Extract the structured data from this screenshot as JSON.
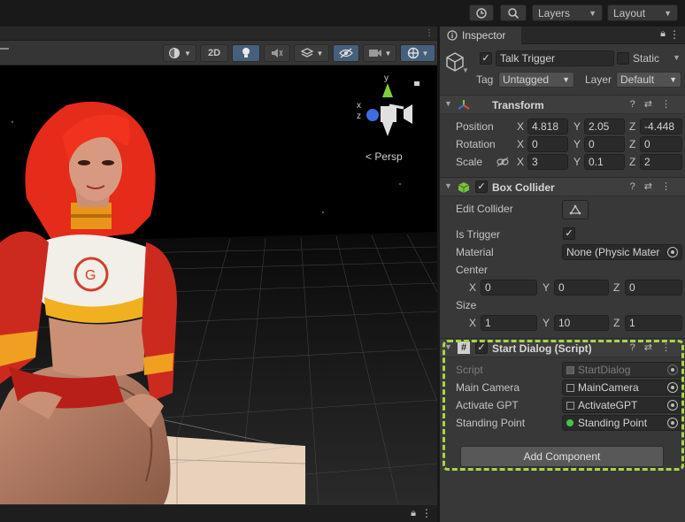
{
  "topbar": {
    "layers_label": "Layers",
    "layout_label": "Layout"
  },
  "scene": {
    "toolbar": {
      "mode_2d": "2D"
    },
    "gizmo": {
      "x": "x",
      "y": "y",
      "z": "z",
      "projection": "Persp"
    }
  },
  "inspector": {
    "tab_label": "Inspector",
    "object": {
      "name": "Talk Trigger",
      "static_label": "Static",
      "static_checked": false,
      "active_checked": true,
      "tag_label": "Tag",
      "tag_value": "Untagged",
      "layer_label": "Layer",
      "layer_value": "Default"
    },
    "transform": {
      "title": "Transform",
      "position_label": "Position",
      "rotation_label": "Rotation",
      "scale_label": "Scale",
      "axis_x": "X",
      "axis_y": "Y",
      "axis_z": "Z",
      "position": {
        "x": "4.818",
        "y": "2.05",
        "z": "-4.448"
      },
      "rotation": {
        "x": "0",
        "y": "0",
        "z": "0"
      },
      "scale": {
        "x": "3",
        "y": "0.1",
        "z": "2"
      }
    },
    "box_collider": {
      "title": "Box Collider",
      "edit_collider_label": "Edit Collider",
      "is_trigger_label": "Is Trigger",
      "is_trigger_checked": true,
      "material_label": "Material",
      "material_value": "None (Physic Mater",
      "center_label": "Center",
      "center": {
        "x": "0",
        "y": "0",
        "z": "0"
      },
      "size_label": "Size",
      "size": {
        "x": "1",
        "y": "10",
        "z": "1"
      }
    },
    "start_dialog": {
      "title": "Start Dialog (Script)",
      "script_label": "Script",
      "script_value": "StartDialog",
      "main_camera_label": "Main Camera",
      "main_camera_value": "MainCamera",
      "activate_gpt_label": "Activate GPT",
      "activate_gpt_value": "ActivateGPT",
      "standing_point_label": "Standing Point",
      "standing_point_value": "Standing Point"
    },
    "add_component_label": "Add Component"
  },
  "colors": {
    "highlight": "#a8d44c",
    "panel_bg": "#383838",
    "field_bg": "#2a2a2a",
    "active_tool": "#46607c"
  }
}
